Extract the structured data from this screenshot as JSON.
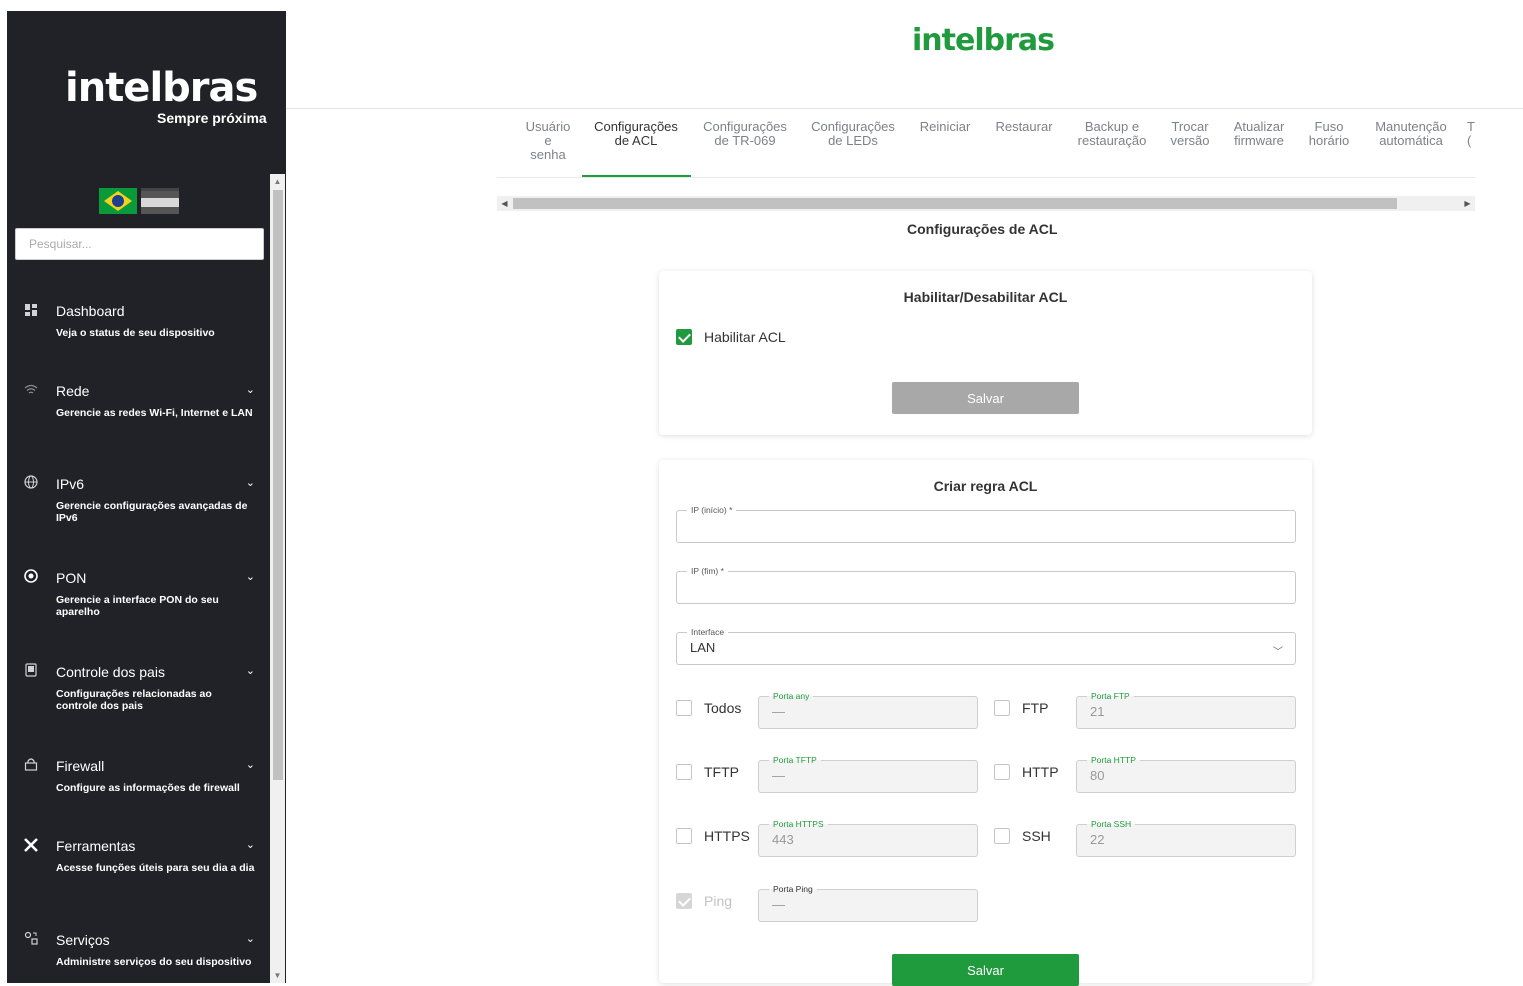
{
  "sidebar": {
    "logo": "intelbras",
    "tagline": "Sempre próxima",
    "search_placeholder": "Pesquisar...",
    "items": [
      {
        "title": "Dashboard",
        "desc": "Veja o status de seu dispositivo",
        "icon": "dashboard-icon",
        "chevron": ""
      },
      {
        "title": "Rede",
        "desc": "Gerencie as redes Wi-Fi, Internet e LAN",
        "icon": "wifi-icon",
        "chevron": "⌄"
      },
      {
        "title": "IPv6",
        "desc": "Gerencie configurações avançadas de IPv6",
        "icon": "globe-icon",
        "chevron": "⌄"
      },
      {
        "title": "PON",
        "desc": "Gerencie a interface PON do seu aparelho",
        "icon": "pon-icon",
        "chevron": "⌄"
      },
      {
        "title": "Controle dos pais",
        "desc": "Configurações relacionadas ao controle dos pais",
        "icon": "phone-icon",
        "chevron": "⌄"
      },
      {
        "title": "Firewall",
        "desc": "Configure as informações de firewall",
        "icon": "lock-icon",
        "chevron": "⌄"
      },
      {
        "title": "Ferramentas",
        "desc": "Acesse funções úteis para seu dia a dia",
        "icon": "tools-icon",
        "chevron": "⌄"
      },
      {
        "title": "Serviços",
        "desc": "Administre serviços do seu dispositivo",
        "icon": "services-icon",
        "chevron": "⌄"
      }
    ]
  },
  "header": {
    "brand": "intelbras"
  },
  "tabs": [
    {
      "label": "Usuário\ne\nsenha"
    },
    {
      "label": "Configurações\nde ACL"
    },
    {
      "label": "Configurações\nde TR-069"
    },
    {
      "label": "Configurações\nde LEDs"
    },
    {
      "label": "Reiniciar"
    },
    {
      "label": "Restaurar"
    },
    {
      "label": "Backup e\nrestauração"
    },
    {
      "label": "Trocar\nversão"
    },
    {
      "label": "Atualizar\nfirmware"
    },
    {
      "label": "Fuso\nhorário"
    },
    {
      "label": "Manutenção\nautomática"
    },
    {
      "label": "T\n("
    }
  ],
  "active_tab": 1,
  "page_title": "Configurações de ACL",
  "enable_card": {
    "title": "Habilitar/Desabilitar ACL",
    "checkbox_label": "Habilitar ACL",
    "checked": true,
    "save_label": "Salvar"
  },
  "rule_card": {
    "title": "Criar regra ACL",
    "ip_start_label": "IP (início) *",
    "ip_start_value": "",
    "ip_end_label": "IP (fim) *",
    "ip_end_value": "",
    "interface_label": "Interface",
    "interface_value": "LAN",
    "services": [
      {
        "name": "Todos",
        "port_label": "Porta any",
        "port_value": "—",
        "checked": false
      },
      {
        "name": "FTP",
        "port_label": "Porta FTP",
        "port_value": "21",
        "checked": false
      },
      {
        "name": "TFTP",
        "port_label": "Porta TFTP",
        "port_value": "—",
        "checked": false
      },
      {
        "name": "HTTP",
        "port_label": "Porta HTTP",
        "port_value": "80",
        "checked": false
      },
      {
        "name": "HTTPS",
        "port_label": "Porta HTTPS",
        "port_value": "443",
        "checked": false
      },
      {
        "name": "SSH",
        "port_label": "Porta SSH",
        "port_value": "22",
        "checked": false
      },
      {
        "name": "Ping",
        "port_label": "Porta Ping",
        "port_value": "—",
        "checked": true,
        "disabled": true
      }
    ],
    "save_label": "Salvar"
  },
  "colors": {
    "accent": "#1f9a3c",
    "sidebar_bg": "#202227"
  }
}
